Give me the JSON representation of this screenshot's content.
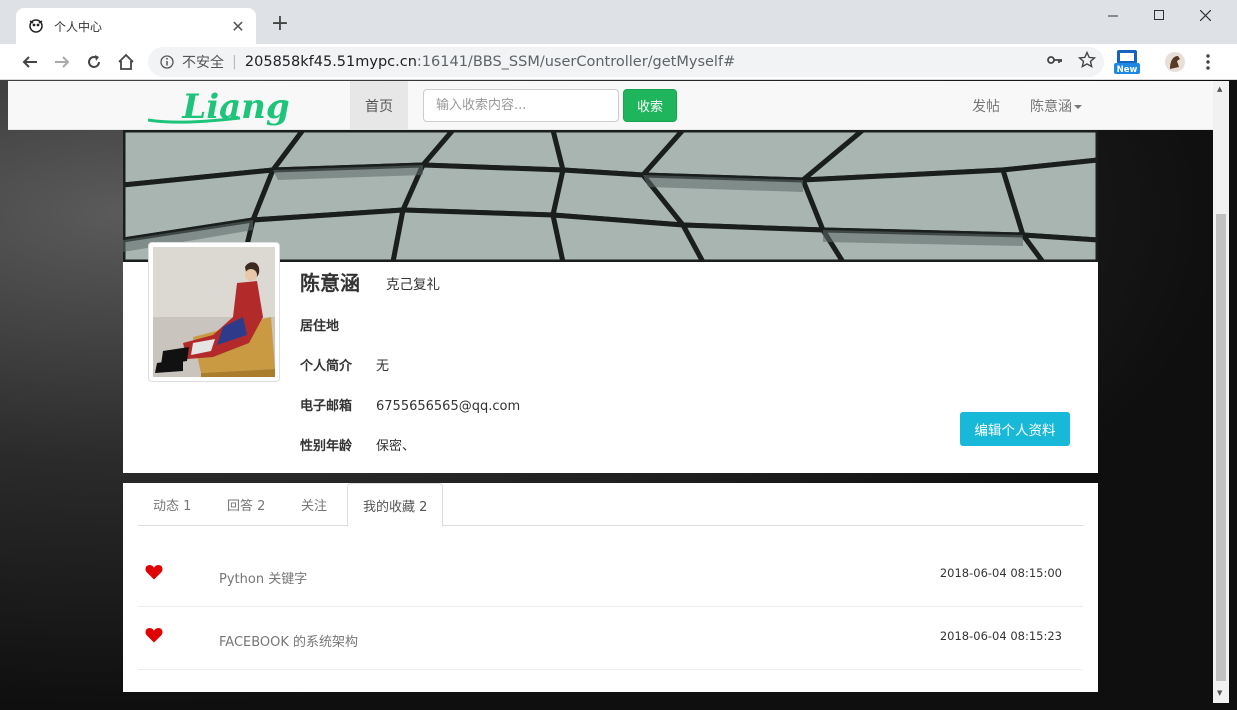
{
  "browser": {
    "tab_title": "个人中心",
    "insecure_label": "不安全",
    "url_host": "205858kf45.51mypc.cn",
    "url_rest": ":16141/BBS_SSM/userController/getMyself#",
    "ext_badge": "New"
  },
  "navbar": {
    "logo_text": "Liang",
    "home_label": "首页",
    "search_placeholder": "输入收索内容...",
    "search_button": "收索",
    "post_label": "发帖",
    "user_label": "陈意涵"
  },
  "profile": {
    "name": "陈意涵",
    "motto": "克己复礼",
    "fields": [
      {
        "label": "居住地",
        "value": ""
      },
      {
        "label": "个人简介",
        "value": "无"
      },
      {
        "label": "电子邮箱",
        "value": "6755656565@qq.com"
      },
      {
        "label": "性别年龄",
        "value": "保密、"
      }
    ],
    "edit_button": "编辑个人资料"
  },
  "tabs": [
    {
      "label": "动态 1",
      "active": false
    },
    {
      "label": "回答 2",
      "active": false
    },
    {
      "label": "关注",
      "active": false
    },
    {
      "label": "我的收藏 2",
      "active": true
    }
  ],
  "favorites": [
    {
      "title": "Python 关键字",
      "time": "2018-06-04 08:15:00"
    },
    {
      "title": "FACEBOOK 的系统架构",
      "time": "2018-06-04 08:15:23"
    }
  ],
  "colors": {
    "accent_green": "#1fb55d",
    "edit_button": "#17b8d8",
    "heart_red": "#e00000",
    "logo_green": "#1ec47a"
  }
}
